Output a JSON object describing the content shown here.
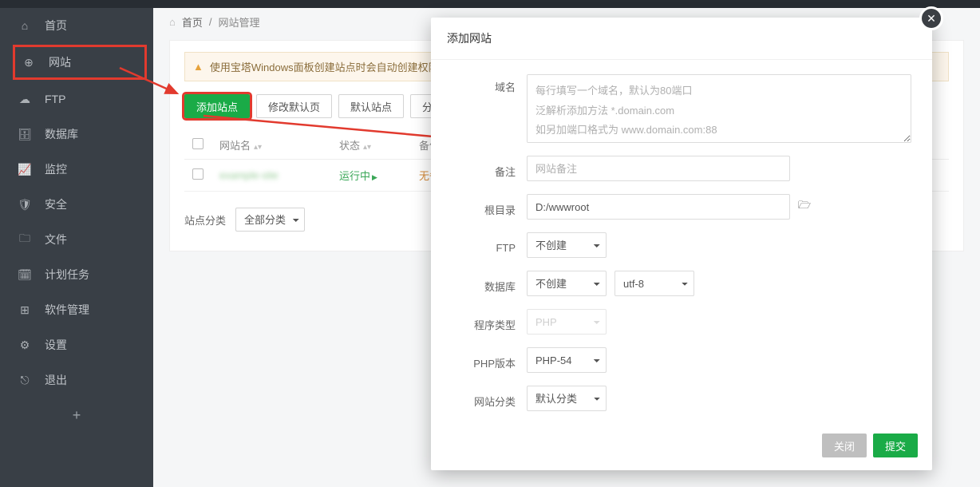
{
  "breadcrumb": {
    "home": "首页",
    "current": "网站管理"
  },
  "sidebar": {
    "items": [
      {
        "label": "首页",
        "icon": "home-icon"
      },
      {
        "label": "网站",
        "icon": "globe-icon"
      },
      {
        "label": "FTP",
        "icon": "cloud-icon"
      },
      {
        "label": "数据库",
        "icon": "database-icon"
      },
      {
        "label": "监控",
        "icon": "chart-icon"
      },
      {
        "label": "安全",
        "icon": "shield-icon"
      },
      {
        "label": "文件",
        "icon": "folder-icon"
      },
      {
        "label": "计划任务",
        "icon": "calendar-icon"
      },
      {
        "label": "软件管理",
        "icon": "grid-icon"
      },
      {
        "label": "设置",
        "icon": "gear-icon"
      },
      {
        "label": "退出",
        "icon": "exit-icon"
      }
    ]
  },
  "alert": {
    "text": "使用宝塔Windows面板创建站点时会自动创建权限配置"
  },
  "toolbar": {
    "add_site": "添加站点",
    "modify_default": "修改默认页",
    "default_site": "默认站点",
    "category": "分类管理"
  },
  "table": {
    "headers": {
      "name": "网站名",
      "status": "状态",
      "backup": "备份"
    },
    "row": {
      "status": "运行中",
      "backup": "无备份"
    }
  },
  "filter": {
    "label": "站点分类",
    "value": "全部分类"
  },
  "modal": {
    "title": "添加网站",
    "labels": {
      "domain": "域名",
      "note": "备注",
      "root": "根目录",
      "ftp": "FTP",
      "db": "数据库",
      "program": "程序类型",
      "php": "PHP版本",
      "category": "网站分类"
    },
    "placeholders": {
      "domain": "每行填写一个域名，默认为80端口\n泛解析添加方法 *.domain.com\n如另加端口格式为 www.domain.com:88",
      "note": "网站备注"
    },
    "values": {
      "root": "D:/wwwroot",
      "ftp": "不创建",
      "db": "不创建",
      "charset": "utf-8",
      "program": "PHP",
      "php": "PHP-54",
      "category": "默认分类"
    },
    "buttons": {
      "close": "关闭",
      "submit": "提交"
    }
  }
}
